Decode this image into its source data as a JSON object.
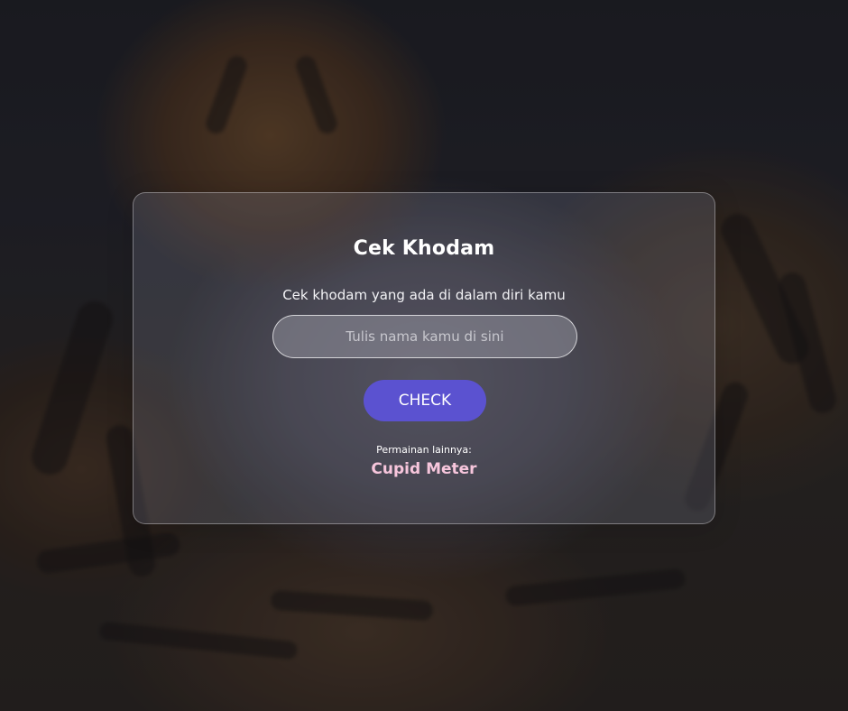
{
  "page": {
    "background_image": "tiger-photo",
    "accent_color": "#5b52d0",
    "link_color": "#f7c6dc"
  },
  "card": {
    "title": "Cek Khodam",
    "subtitle": "Cek khodam yang ada di dalam diri kamu",
    "name_input": {
      "value": "",
      "placeholder": "Tulis nama kamu di sini"
    },
    "check_button_label": "CHECK",
    "other_games_label": "Permainan lainnya:",
    "other_game_link": "Cupid Meter"
  }
}
